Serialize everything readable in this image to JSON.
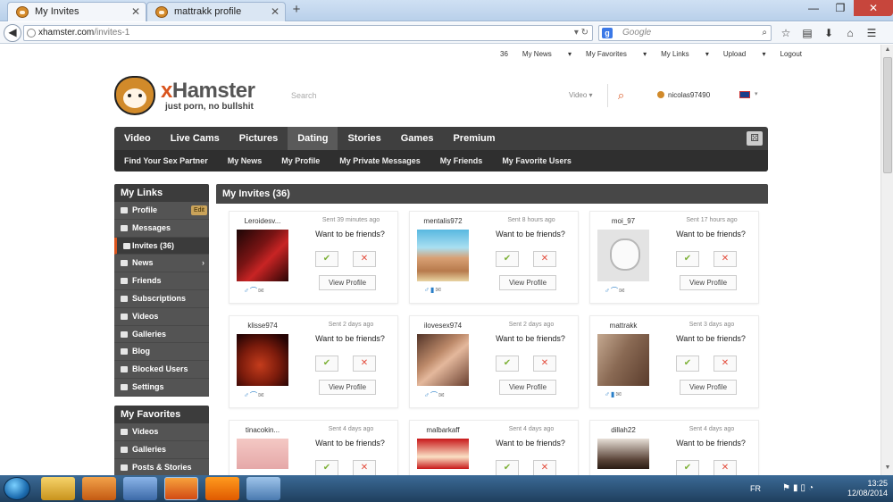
{
  "browser": {
    "tabs": [
      {
        "title": "My Invites",
        "active": true
      },
      {
        "title": "mattrakk profile",
        "active": false
      }
    ],
    "url_host": "xhamster.com",
    "url_path": "/invites-1",
    "search_placeholder": "Google"
  },
  "header": {
    "links": [
      "36",
      "My News",
      "My Favorites",
      "My Links",
      "Upload",
      "Logout"
    ],
    "brand_x": "x",
    "brand_rest": "Hamster",
    "tagline": "just porn, no bullshit",
    "search_placeholder": "Search",
    "search_type": "Video",
    "username": "nicolas97490"
  },
  "main_nav": {
    "primary": [
      "Video",
      "Live Cams",
      "Pictures",
      "Dating",
      "Stories",
      "Games",
      "Premium"
    ],
    "active": "Dating",
    "secondary": [
      "Find Your Sex Partner",
      "My News",
      "My Profile",
      "My Private Messages",
      "My Friends",
      "My Favorite Users"
    ]
  },
  "sidebar": {
    "my_links_title": "My Links",
    "items": [
      {
        "label": "Profile",
        "badge": "Edit"
      },
      {
        "label": "Messages"
      },
      {
        "label": "Invites (36)",
        "active": true
      },
      {
        "label": "News",
        "chevron": true
      },
      {
        "label": "Friends"
      },
      {
        "label": "Subscriptions"
      },
      {
        "label": "Videos"
      },
      {
        "label": "Galleries"
      },
      {
        "label": "Blog"
      },
      {
        "label": "Blocked Users"
      },
      {
        "label": "Settings"
      }
    ],
    "favorites_title": "My Favorites",
    "favorites": [
      {
        "label": "Videos"
      },
      {
        "label": "Galleries"
      },
      {
        "label": "Posts & Stories"
      }
    ]
  },
  "invites": {
    "title": "My Invites (36)",
    "question": "Want to be friends?",
    "view_label": "View Profile",
    "accept_glyph": "✔",
    "decline_glyph": "✕",
    "cards": [
      {
        "user": "Leroidesv...",
        "sent": "Sent 39 minutes ago",
        "thumb": "th-red",
        "flag": false
      },
      {
        "user": "mentalis972",
        "sent": "Sent 8 hours ago",
        "thumb": "th-beach",
        "flag": true
      },
      {
        "user": "moi_97",
        "sent": "Sent 17 hours ago",
        "thumb": "th-default",
        "flag": false
      },
      {
        "user": "klisse974",
        "sent": "Sent 2 days ago",
        "thumb": "th-dark",
        "flag": false
      },
      {
        "user": "ilovesex974",
        "sent": "Sent 2 days ago",
        "thumb": "th-skin",
        "flag": false
      },
      {
        "user": "mattrakk",
        "sent": "Sent 3 days ago",
        "thumb": "th-brown",
        "flag": true
      },
      {
        "user": "tinacokin...",
        "sent": "Sent 4 days ago",
        "thumb": "th-pink",
        "flag": false
      },
      {
        "user": "malbarkaff",
        "sent": "Sent 4 days ago",
        "thumb": "th-comic",
        "flag": false
      },
      {
        "user": "dillah22",
        "sent": "Sent 4 days ago",
        "thumb": "th-photo",
        "flag": false
      }
    ]
  },
  "taskbar": {
    "lang": "FR",
    "time": "13:25",
    "date": "12/08/2014"
  }
}
